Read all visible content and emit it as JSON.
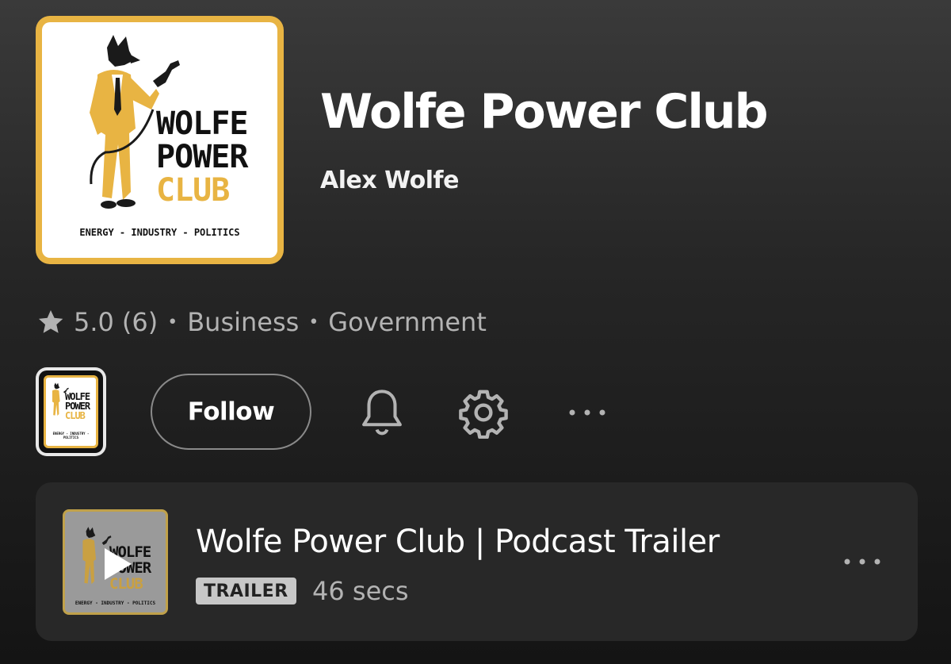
{
  "podcast": {
    "title": "Wolfe Power Club",
    "author": "Alex Wolfe",
    "cover_text": {
      "line1": "WOLFE",
      "line2": "POWER",
      "line3": "CLUB",
      "tagline": "ENERGY - INDUSTRY - POLITICS"
    },
    "rating": "5.0",
    "rating_count": "(6)",
    "categories": [
      "Business",
      "Government"
    ]
  },
  "actions": {
    "follow_label": "Follow",
    "icons": [
      "bell-icon",
      "gear-icon",
      "more-icon"
    ]
  },
  "episode": {
    "title": "Wolfe Power Club | Podcast Trailer",
    "badge": "TRAILER",
    "duration": "46 secs"
  },
  "colors": {
    "accent_gold": "#e8b443",
    "text_secondary": "#b3b3b3",
    "card_bg": "#282828"
  }
}
